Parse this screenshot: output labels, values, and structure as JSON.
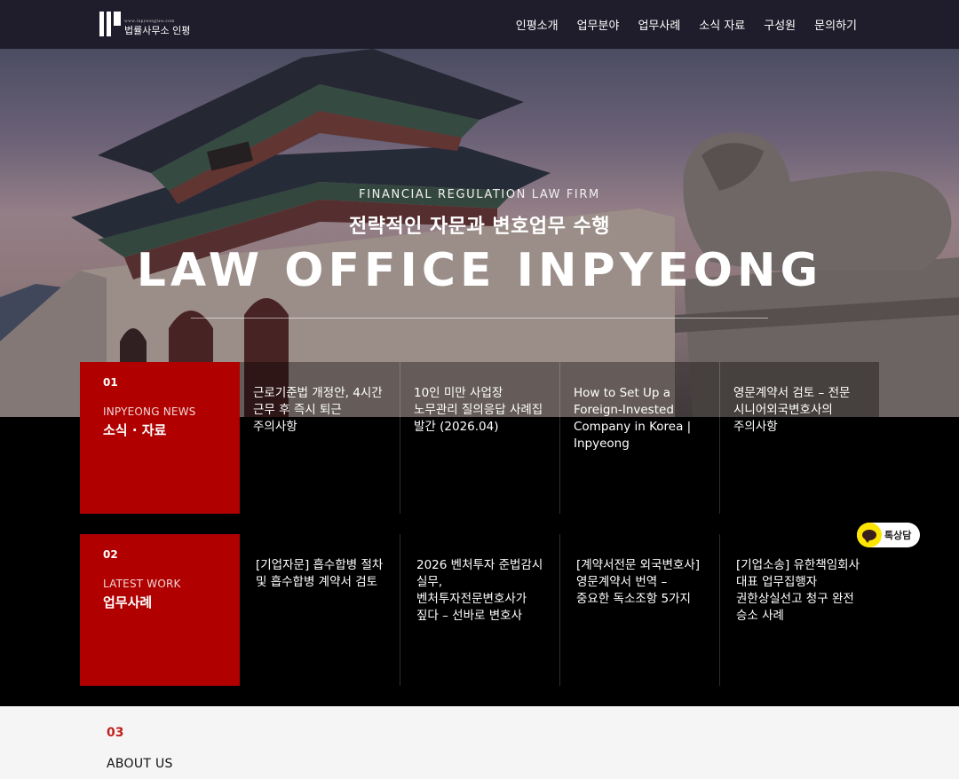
{
  "header": {
    "logo_url": "www.inpyeonglaw.com",
    "logo_name": "법률사무소 인평",
    "nav": [
      "인평소개",
      "업무분야",
      "업무사례",
      "소식 자료",
      "구성원",
      "문의하기"
    ]
  },
  "hero": {
    "kicker": "FINANCIAL REGULATION LAW FIRM",
    "subtitle": "전략적인 자문과 변호업무 수행",
    "title": "LAW OFFICE INPYEONG"
  },
  "news": {
    "number": "01",
    "label_en": "INPYEONG NEWS",
    "label_ko": "소식 · 자료",
    "items": [
      "근로기준법 개정안, 4시간 근무 후 즉시 퇴근 주의사항",
      "10인 미만 사업장 노무관리 질의응답 사례집 발간 (2026.04)",
      "How to Set Up a Foreign-Invested Company in Korea | Inpyeong",
      "영문계약서 검토 – 전문 시니어외국변호사의 주의사항"
    ]
  },
  "work": {
    "number": "02",
    "label_en": "LATEST WORK",
    "label_ko": "업무사례",
    "items": [
      "[기업자문] 흡수합병 절차 및 흡수합병 계약서 검토",
      "2026 벤처투자 준법감시 실무, 벤처투자전문변호사가 짚다 – 선바로 변호사",
      "[계약서전문 외국변호사] 영문계약서 번역 – 중요한 독소조항 5가지",
      "[기업소송] 유한책임회사 대표 업무집행자 권한상실선고 청구 완전 승소 사례"
    ]
  },
  "kakao": {
    "label": "톡상담",
    "icon": "kakao-talk-icon",
    "color": "#fee500"
  },
  "about": {
    "number": "03",
    "title": "ABOUT US"
  },
  "colors": {
    "accent": "#b00000",
    "header_bg": "#1f1d2b",
    "about_number": "#c0201e"
  }
}
